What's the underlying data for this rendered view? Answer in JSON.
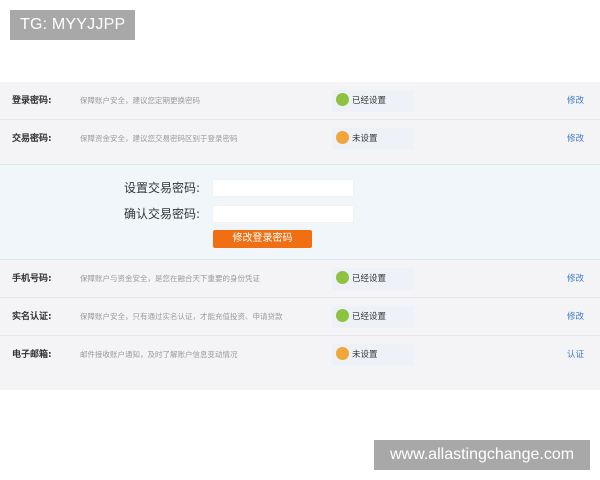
{
  "watermarks": {
    "top": "TG: MYYJJPP",
    "bottom": "www.allastingchange.com"
  },
  "rows": [
    {
      "label": "登录密码:",
      "desc": "保障账户安全，建议您定期更换密码",
      "status": "已经设置",
      "status_color": "green",
      "action": "修改"
    },
    {
      "label": "交易密码:",
      "desc": "保障资金安全，建议您交易密码区别于登录密码",
      "status": "未设置",
      "status_color": "orange",
      "action": "修改"
    },
    {
      "label": "手机号码:",
      "desc": "保障账户与资金安全，是您在融合天下重要的身份凭证",
      "status": "已经设置",
      "status_color": "green",
      "action": "修改"
    },
    {
      "label": "实名认证:",
      "desc": "保障账户安全，只有通过实名认证，才能充值投资、申请贷款",
      "status": "已经设置",
      "status_color": "green",
      "action": "修改"
    },
    {
      "label": "电子邮箱:",
      "desc": "邮件接收账户通知，及时了解账户信息变动情况",
      "status": "未设置",
      "status_color": "orange",
      "action": "认证"
    }
  ],
  "trade_password_form": {
    "set_label": "设置交易密码:",
    "set_value": "",
    "confirm_label": "确认交易密码:",
    "confirm_value": "",
    "submit_label": "修改登录密码"
  },
  "colors": {
    "green": "#8dc33f",
    "orange": "#f0a63a",
    "link": "#3d7ac5",
    "submit": "#f06f12"
  }
}
